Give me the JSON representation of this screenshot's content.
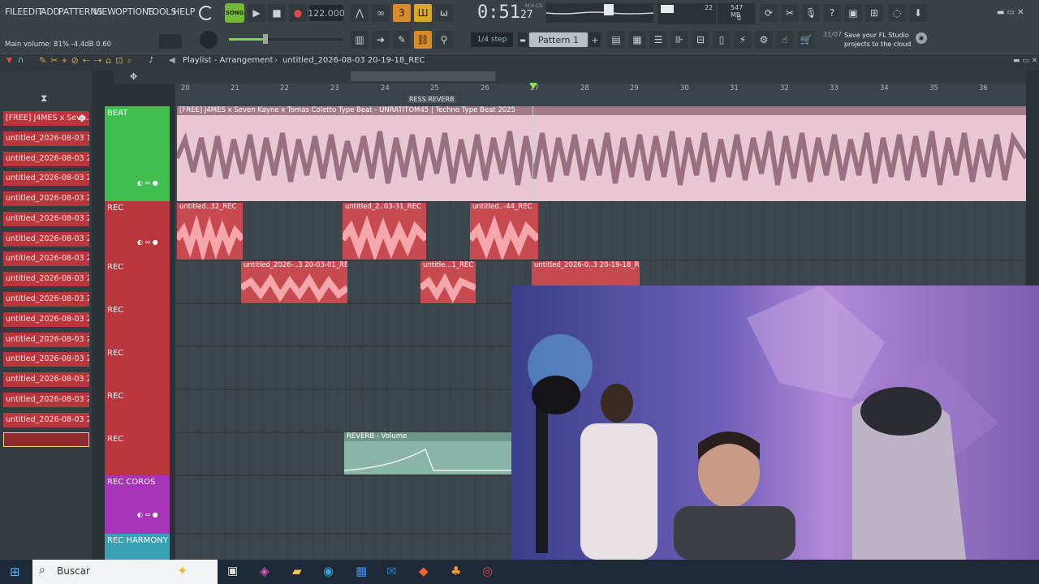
{
  "menu": [
    "FILE",
    "EDIT",
    "ADD",
    "PATTERNS",
    "VIEW",
    "OPTIONS",
    "TOOLS",
    "HELP"
  ],
  "transport": {
    "mode": "SONG",
    "tempo": "122.000",
    "time": "0:51",
    "time_frac": "27",
    "time_label": "M:S:CS",
    "pattern": "Pattern 1",
    "step": "1/4 step"
  },
  "status": {
    "main_volume": "Main volume: 81%  -4.4dB  0.60",
    "cpu": "22",
    "mem": "547 MB",
    "mem2": "0"
  },
  "cloud": {
    "date": "31/07",
    "text": "Save your FL Studio projects to the cloud"
  },
  "playlist": {
    "title": "Playlist - Arrangement",
    "project": "untitled_2026-08-03 20-19-18_REC",
    "marker": "RESS REVERB"
  },
  "ruler": [
    "20",
    "21",
    "22",
    "23",
    "24",
    "25",
    "26",
    "27",
    "28",
    "29",
    "30",
    "31",
    "32",
    "33",
    "34",
    "35",
    "36"
  ],
  "patterns": [
    "[FREE] J4MES x Seve...",
    "untitled_2026-08-03 19-...",
    "untitled_2026-08-03 20-...",
    "untitled_2026-08-03 20-...",
    "untitled_2026-08-03 20-...",
    "untitled_2026-08-03 20-...",
    "untitled_2026-08-03 20-...",
    "untitled_2026-08-03 20-...",
    "untitled_2026-08-03 20-...",
    "untitled_2026-08-03 20-...",
    "untitled_2026-08-03 20-...",
    "untitled_2026-08-03 20-...",
    "untitled_2026-08-03 20-...",
    "untitled_2026-08-03 20-...",
    "untitled_2026-08-03 20-...",
    "untitled_2026-08-03 20-..."
  ],
  "tracks": [
    "BEAT",
    "REC",
    "REC",
    "REC",
    "REC",
    "REC",
    "REC",
    "REC COROS",
    "REC HARMONY"
  ],
  "clips": {
    "beat": "[FREE] J4MES x Seven Kayne x Tomas Coletto Type Beat - UNRATITOM45 | Techno Type Beat 2025",
    "r1a": "untitled..32_REC",
    "r1b": "untitled_2..03-31_REC",
    "r1c": "untitled..-44_REC",
    "r2a": "untitled_2026-..3 20-03-01_REC",
    "r2b": "untitle...1_REC",
    "r2c": "untitled_2026-0..3 20-19-18_REC",
    "auto": "REVERB - Volume"
  },
  "taskbar": {
    "search": "Buscar"
  },
  "colors": {
    "clip_red": "#e0666d",
    "beat_pink": "#e8c7d3",
    "track_green": "#3fbf4e",
    "track_red": "#b9363d",
    "track_purple": "#a733b8",
    "track_teal": "#3aa0b3"
  }
}
